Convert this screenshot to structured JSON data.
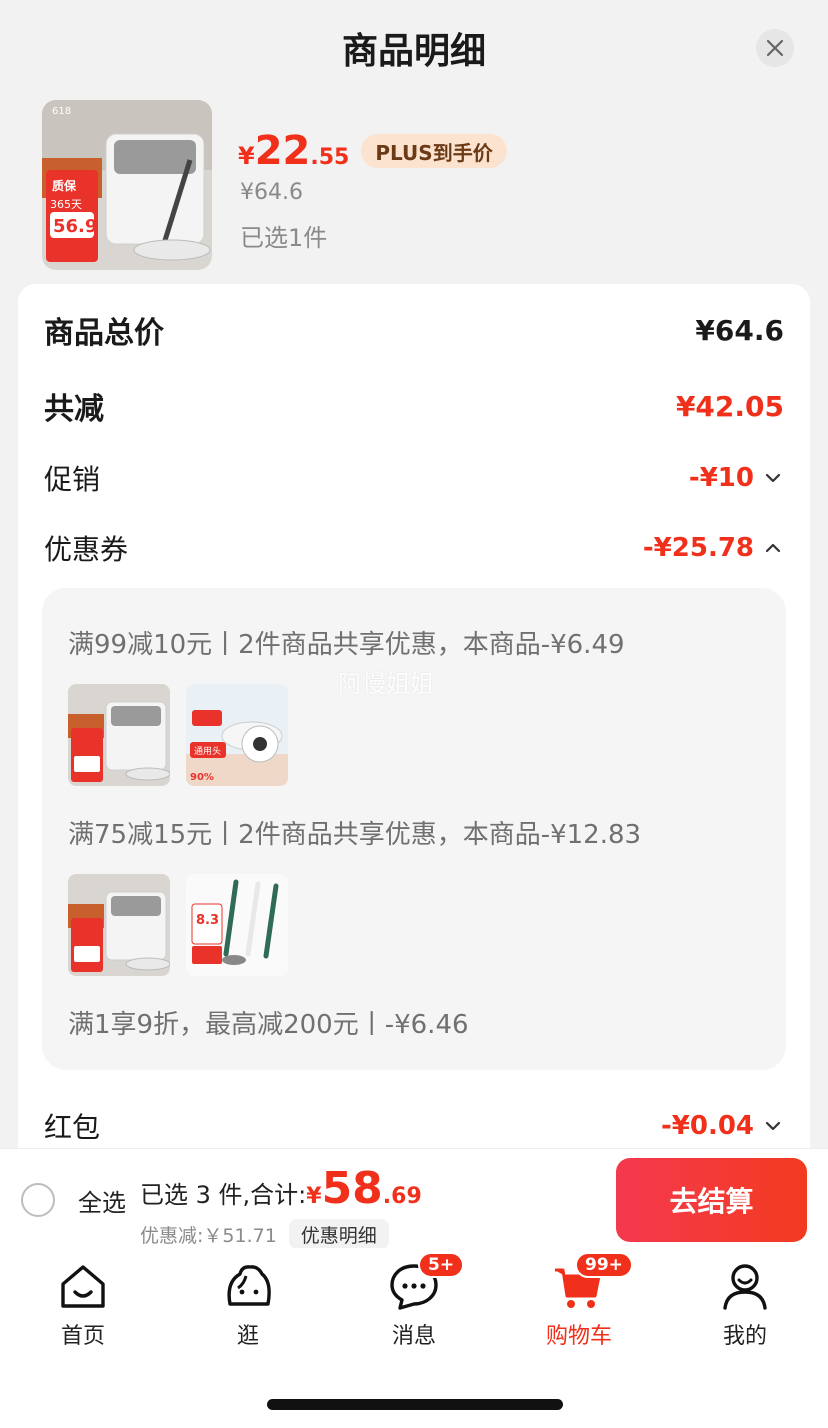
{
  "sheet": {
    "title": "商品明细"
  },
  "product": {
    "thumb_tags": {
      "promo": "618",
      "warranty": "质保",
      "days": "365天",
      "price": "56.9"
    },
    "price_symbol": "¥",
    "price_integer": "22",
    "price_decimal": ".55",
    "plus_tag": "PLUS到手价",
    "original_price": "¥64.6",
    "selected_count": "已选1件"
  },
  "summary": {
    "total_label": "商品总价",
    "total_value": "¥64.6",
    "reduction_label": "共减",
    "reduction_value": "¥42.05",
    "promo_label": "促销",
    "promo_value": "-¥10",
    "coupon_label": "优惠券",
    "coupon_value": "-¥25.78",
    "redpacket_label": "红包",
    "redpacket_value": "-¥0.04"
  },
  "coupons": [
    {
      "text": "满99减10元丨2件商品共享优惠，本商品-¥6.49"
    },
    {
      "text": "满75减15元丨2件商品共享优惠，本商品-¥12.83"
    },
    {
      "text": "满1享9折，最高减200元丨-¥6.46"
    }
  ],
  "coupon_thumbs": {
    "pad_tag": "通用头",
    "pad_discount": "90%",
    "brush_price": "8.3"
  },
  "watermark": "阿慢姐姐",
  "checkout": {
    "select_all": "全选",
    "total_prefix": "已选 3 件,合计:",
    "total_symbol": "¥",
    "total_integer": "58",
    "total_decimal": ".69",
    "discount_text": "优惠减:￥51.71",
    "detail_chip": "优惠明细",
    "button": "去结算"
  },
  "tabbar": {
    "tabs": [
      {
        "label": "首页",
        "icon": "home-icon"
      },
      {
        "label": "逛",
        "icon": "browse-icon"
      },
      {
        "label": "消息",
        "icon": "message-icon",
        "badge": "5+"
      },
      {
        "label": "购物车",
        "icon": "cart-icon",
        "badge": "99+",
        "active": true
      },
      {
        "label": "我的",
        "icon": "profile-icon"
      }
    ]
  },
  "colors": {
    "accent": "#f0301b",
    "plus_tag_bg": "#fbe3cf"
  }
}
